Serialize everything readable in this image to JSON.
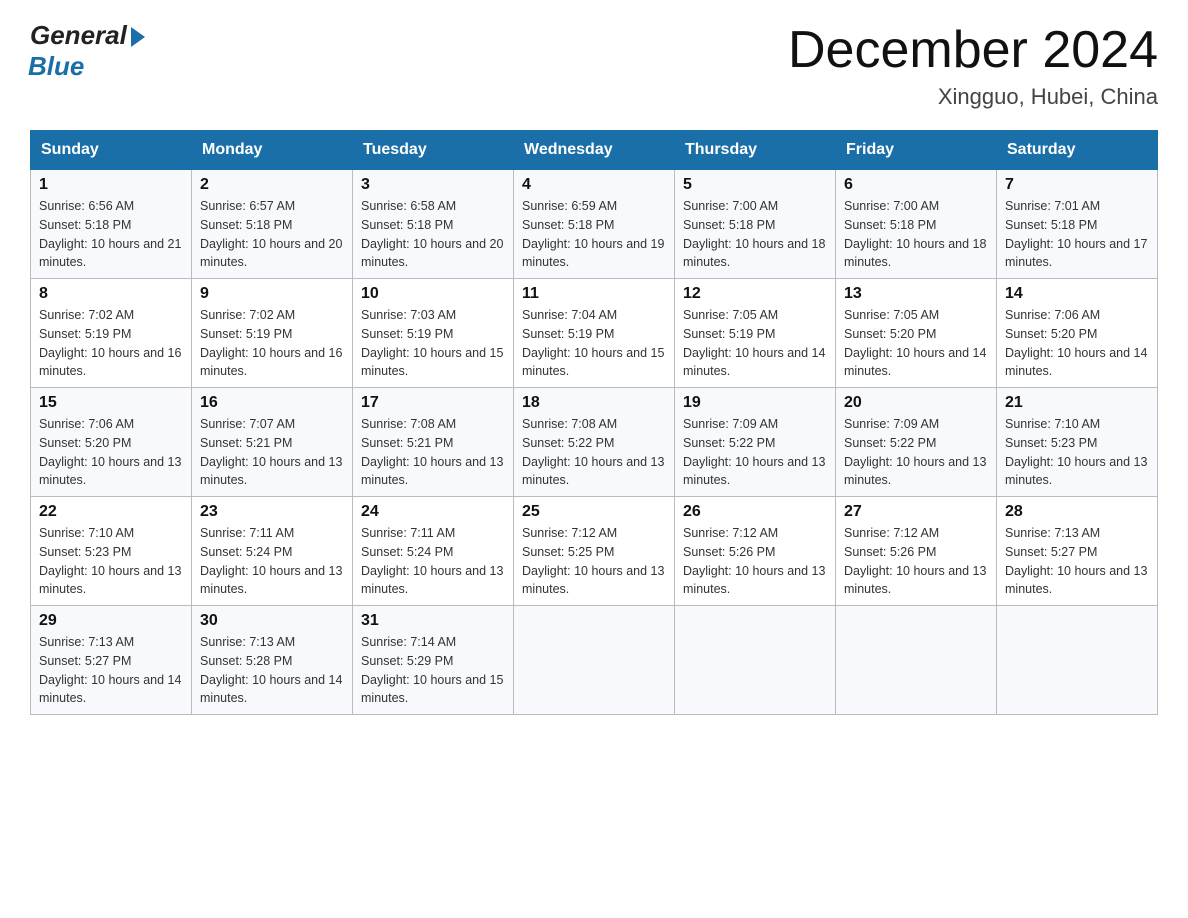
{
  "header": {
    "logo_general": "General",
    "logo_blue": "Blue",
    "title": "December 2024",
    "location": "Xingguo, Hubei, China"
  },
  "days_of_week": [
    "Sunday",
    "Monday",
    "Tuesday",
    "Wednesday",
    "Thursday",
    "Friday",
    "Saturday"
  ],
  "weeks": [
    [
      {
        "day": "1",
        "sunrise": "6:56 AM",
        "sunset": "5:18 PM",
        "daylight": "10 hours and 21 minutes."
      },
      {
        "day": "2",
        "sunrise": "6:57 AM",
        "sunset": "5:18 PM",
        "daylight": "10 hours and 20 minutes."
      },
      {
        "day": "3",
        "sunrise": "6:58 AM",
        "sunset": "5:18 PM",
        "daylight": "10 hours and 20 minutes."
      },
      {
        "day": "4",
        "sunrise": "6:59 AM",
        "sunset": "5:18 PM",
        "daylight": "10 hours and 19 minutes."
      },
      {
        "day": "5",
        "sunrise": "7:00 AM",
        "sunset": "5:18 PM",
        "daylight": "10 hours and 18 minutes."
      },
      {
        "day": "6",
        "sunrise": "7:00 AM",
        "sunset": "5:18 PM",
        "daylight": "10 hours and 18 minutes."
      },
      {
        "day": "7",
        "sunrise": "7:01 AM",
        "sunset": "5:18 PM",
        "daylight": "10 hours and 17 minutes."
      }
    ],
    [
      {
        "day": "8",
        "sunrise": "7:02 AM",
        "sunset": "5:19 PM",
        "daylight": "10 hours and 16 minutes."
      },
      {
        "day": "9",
        "sunrise": "7:02 AM",
        "sunset": "5:19 PM",
        "daylight": "10 hours and 16 minutes."
      },
      {
        "day": "10",
        "sunrise": "7:03 AM",
        "sunset": "5:19 PM",
        "daylight": "10 hours and 15 minutes."
      },
      {
        "day": "11",
        "sunrise": "7:04 AM",
        "sunset": "5:19 PM",
        "daylight": "10 hours and 15 minutes."
      },
      {
        "day": "12",
        "sunrise": "7:05 AM",
        "sunset": "5:19 PM",
        "daylight": "10 hours and 14 minutes."
      },
      {
        "day": "13",
        "sunrise": "7:05 AM",
        "sunset": "5:20 PM",
        "daylight": "10 hours and 14 minutes."
      },
      {
        "day": "14",
        "sunrise": "7:06 AM",
        "sunset": "5:20 PM",
        "daylight": "10 hours and 14 minutes."
      }
    ],
    [
      {
        "day": "15",
        "sunrise": "7:06 AM",
        "sunset": "5:20 PM",
        "daylight": "10 hours and 13 minutes."
      },
      {
        "day": "16",
        "sunrise": "7:07 AM",
        "sunset": "5:21 PM",
        "daylight": "10 hours and 13 minutes."
      },
      {
        "day": "17",
        "sunrise": "7:08 AM",
        "sunset": "5:21 PM",
        "daylight": "10 hours and 13 minutes."
      },
      {
        "day": "18",
        "sunrise": "7:08 AM",
        "sunset": "5:22 PM",
        "daylight": "10 hours and 13 minutes."
      },
      {
        "day": "19",
        "sunrise": "7:09 AM",
        "sunset": "5:22 PM",
        "daylight": "10 hours and 13 minutes."
      },
      {
        "day": "20",
        "sunrise": "7:09 AM",
        "sunset": "5:22 PM",
        "daylight": "10 hours and 13 minutes."
      },
      {
        "day": "21",
        "sunrise": "7:10 AM",
        "sunset": "5:23 PM",
        "daylight": "10 hours and 13 minutes."
      }
    ],
    [
      {
        "day": "22",
        "sunrise": "7:10 AM",
        "sunset": "5:23 PM",
        "daylight": "10 hours and 13 minutes."
      },
      {
        "day": "23",
        "sunrise": "7:11 AM",
        "sunset": "5:24 PM",
        "daylight": "10 hours and 13 minutes."
      },
      {
        "day": "24",
        "sunrise": "7:11 AM",
        "sunset": "5:24 PM",
        "daylight": "10 hours and 13 minutes."
      },
      {
        "day": "25",
        "sunrise": "7:12 AM",
        "sunset": "5:25 PM",
        "daylight": "10 hours and 13 minutes."
      },
      {
        "day": "26",
        "sunrise": "7:12 AM",
        "sunset": "5:26 PM",
        "daylight": "10 hours and 13 minutes."
      },
      {
        "day": "27",
        "sunrise": "7:12 AM",
        "sunset": "5:26 PM",
        "daylight": "10 hours and 13 minutes."
      },
      {
        "day": "28",
        "sunrise": "7:13 AM",
        "sunset": "5:27 PM",
        "daylight": "10 hours and 13 minutes."
      }
    ],
    [
      {
        "day": "29",
        "sunrise": "7:13 AM",
        "sunset": "5:27 PM",
        "daylight": "10 hours and 14 minutes."
      },
      {
        "day": "30",
        "sunrise": "7:13 AM",
        "sunset": "5:28 PM",
        "daylight": "10 hours and 14 minutes."
      },
      {
        "day": "31",
        "sunrise": "7:14 AM",
        "sunset": "5:29 PM",
        "daylight": "10 hours and 15 minutes."
      },
      null,
      null,
      null,
      null
    ]
  ]
}
